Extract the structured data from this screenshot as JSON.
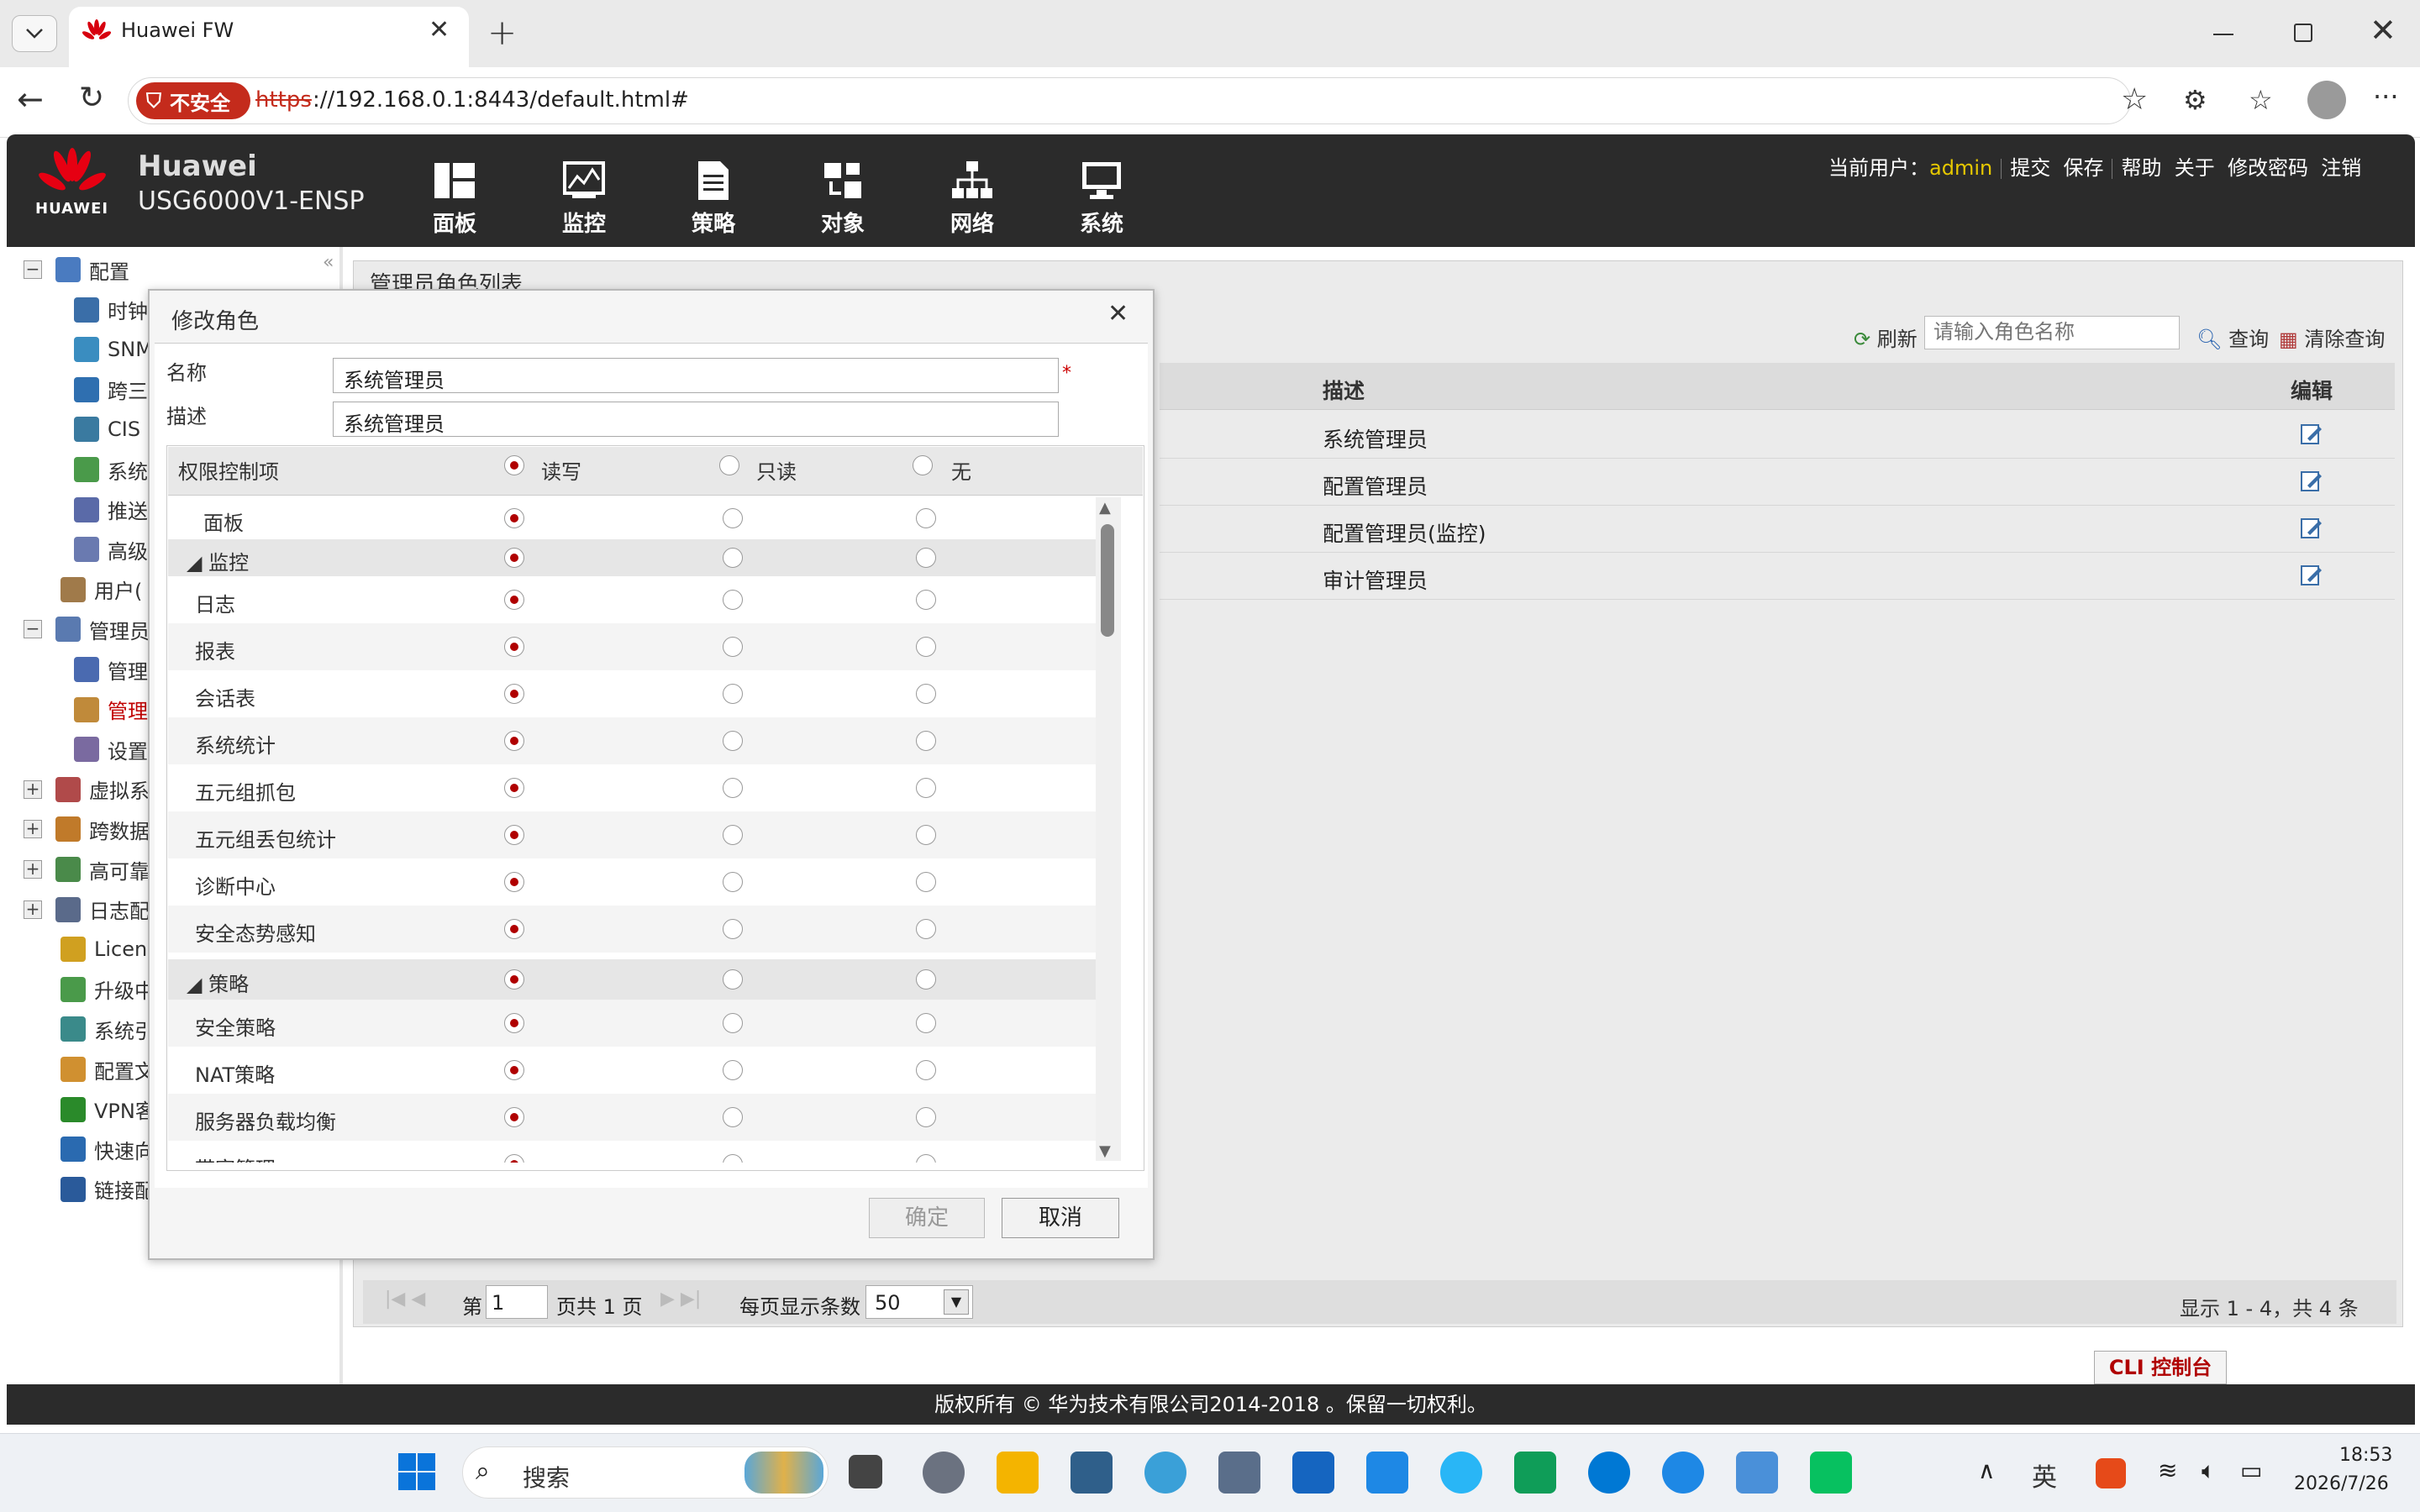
{
  "browser": {
    "tab_title": "Huawei FW",
    "insecure_label": "不安全",
    "url_scheme": "https",
    "url_rest": "://192.168.0.1:8443/default.html#"
  },
  "header": {
    "brand_name": "Huawei",
    "model": "USG6000V1-ENSP",
    "logo_text": "HUAWEI",
    "nav": [
      "面板",
      "监控",
      "策略",
      "对象",
      "网络",
      "系统"
    ],
    "current_user_label": "当前用户：",
    "current_user": "admin",
    "links": [
      "提交",
      "保存",
      "帮助",
      "关于",
      "修改密码",
      "注销"
    ]
  },
  "sidebar": {
    "items": [
      {
        "label": "配置",
        "exp": "−"
      },
      {
        "label": "时钟"
      },
      {
        "label": "SNM"
      },
      {
        "label": "跨三"
      },
      {
        "label": "CIS"
      },
      {
        "label": "系统"
      },
      {
        "label": "推送"
      },
      {
        "label": "高级"
      },
      {
        "label": "用户("
      },
      {
        "label": "管理员",
        "exp": "−"
      },
      {
        "label": "管理"
      },
      {
        "label": "管理"
      },
      {
        "label": "设置"
      },
      {
        "label": "虚拟系",
        "exp": "+"
      },
      {
        "label": "跨数据",
        "exp": "+"
      },
      {
        "label": "高可靠",
        "exp": "+"
      },
      {
        "label": "日志配",
        "exp": "+"
      },
      {
        "label": "Licen"
      },
      {
        "label": "升级中"
      },
      {
        "label": "系统引"
      },
      {
        "label": "配置文"
      },
      {
        "label": "VPN客"
      },
      {
        "label": "快速向"
      },
      {
        "label": "链接配"
      }
    ]
  },
  "main": {
    "title": "管理员角色列表",
    "refresh": "刷新",
    "search_placeholder": "请输入角色名称",
    "query": "查询",
    "clear_query": "清除查询",
    "columns": {
      "desc": "描述",
      "edit": "编辑"
    },
    "rows": [
      {
        "desc": "系统管理员"
      },
      {
        "desc": "配置管理员"
      },
      {
        "desc": "配置管理员(监控)"
      },
      {
        "desc": "审计管理员"
      }
    ],
    "pager": {
      "page_prefix": "第",
      "page_value": "1",
      "page_suffix": "页共 1 页",
      "per_page_label": "每页显示条数",
      "per_page_value": "50",
      "info": "显示 1 - 4，共 4 条"
    },
    "cli_button": "CLI 控制台"
  },
  "footer": "版权所有 © 华为技术有限公司2014-2018 。保留一切权利。",
  "dialog": {
    "title": "修改角色",
    "name_label": "名称",
    "name_value": "系统管理员",
    "desc_label": "描述",
    "desc_value": "系统管理员",
    "perm_header": "权限控制项",
    "opt_rw": "读写",
    "opt_ro": "只读",
    "opt_none": "无",
    "rows": [
      {
        "label": "面板",
        "type": "item0"
      },
      {
        "label": "◢ 监控",
        "type": "grp"
      },
      {
        "label": "日志"
      },
      {
        "label": "报表"
      },
      {
        "label": "会话表"
      },
      {
        "label": "系统统计"
      },
      {
        "label": "五元组抓包"
      },
      {
        "label": "五元组丢包统计"
      },
      {
        "label": "诊断中心"
      },
      {
        "label": "安全态势感知"
      },
      {
        "label": "◢ 策略",
        "type": "grp"
      },
      {
        "label": "安全策略"
      },
      {
        "label": "NAT策略"
      },
      {
        "label": "服务器负载均衡"
      },
      {
        "label": "带宽管理"
      }
    ],
    "ok": "确定",
    "cancel": "取消"
  },
  "taskbar": {
    "search": "搜索",
    "ime": "英",
    "time": "18:53",
    "date": "2026/7/26"
  }
}
